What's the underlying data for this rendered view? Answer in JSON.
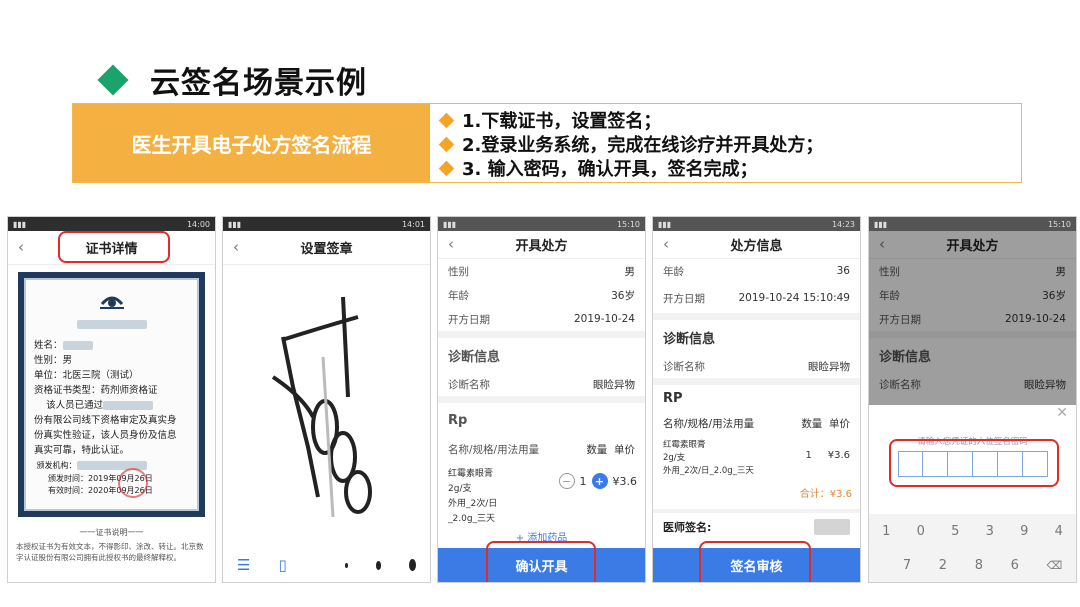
{
  "header": {
    "title": "云签名场景示例"
  },
  "banner": {
    "left_label": "医生开具电子处方签名流程",
    "steps": [
      "1.下载证书，设置签名；",
      "2.登录业务系统，完成在线诊疗并开具处方；",
      "3. 输入密码，确认开具，签名完成；"
    ]
  },
  "phone1": {
    "status_time": "14:00",
    "nav_title": "证书详情",
    "cert": {
      "name_label": "姓名：",
      "gender": "性别：男",
      "unit": "单位：北医三院（测试）",
      "cert_type": "资格证书类型：药剂师资格证",
      "passed": "该人员已通过",
      "line1": "份有限公司线下资格审定及真实身",
      "line2": "份真实性验证，该人员身份及信息",
      "line3": "真实可靠，特此认证。",
      "issuer": "颁发机构：",
      "issue_time": "颁发时间：2019年09月26日",
      "valid_time": "有效时间：2020年09月26日"
    },
    "footer_title": "一一证书说明一一",
    "footer_text": "本授权证书为有效文本，不得影印、涂改、转让。北京数字认证股份有限公司拥有此授权书的最终解释权。"
  },
  "phone2": {
    "status_time": "14:01",
    "nav_title": "设置签章"
  },
  "phone3": {
    "status_time": "15:10",
    "nav_title": "开具处方",
    "rows": [
      {
        "k": "性别",
        "v": "男"
      },
      {
        "k": "年龄",
        "v": "36岁"
      },
      {
        "k": "开方日期",
        "v": "2019-10-24"
      }
    ],
    "diag_title": "诊断信息",
    "diag_name_k": "诊断名称",
    "diag_name_v": "眼睑异物",
    "rp_title": "Rp",
    "drug_header": "名称/规格/用法用量",
    "qty_header": "数量",
    "price_header": "单价",
    "drug_name": "红霉素眼膏",
    "drug_spec": "2g/支",
    "drug_usage": "外用_2次/日_2.0g_三天",
    "qty": "1",
    "price": "¥3.6",
    "add_drug": "+ 添加药品",
    "button": "确认开具"
  },
  "phone4": {
    "status_time": "14:23",
    "nav_title": "处方信息",
    "rows": [
      {
        "k": "年龄",
        "v": "36"
      },
      {
        "k": "开方日期",
        "v": "2019-10-24 15:10:49"
      }
    ],
    "diag_title": "诊断信息",
    "diag_name_k": "诊断名称",
    "diag_name_v": "眼睑异物",
    "rp_title": "RP",
    "drug_header": "名称/规格/用法用量",
    "qty_header": "数量",
    "price_header": "单价",
    "drug_name": "红霉素眼膏",
    "drug_spec": "2g/支",
    "drug_usage": "外用_2次/日_2.0g_三天",
    "qty": "1",
    "price": "¥3.6",
    "total": "合计：¥3.6",
    "signer": "医师签名:",
    "button": "签名审核"
  },
  "phone5": {
    "status_time": "15:10",
    "nav_title": "开具处方",
    "rows": [
      {
        "k": "性别",
        "v": "男"
      },
      {
        "k": "年龄",
        "v": "36岁"
      },
      {
        "k": "开方日期",
        "v": "2019-10-24"
      }
    ],
    "diag_title": "诊断信息",
    "diag_name_k": "诊断名称",
    "diag_name_v": "眼睑异物",
    "pwd_prompt": "请输入您凭证的六位签名密码",
    "keys_row1": [
      "1",
      "0",
      "5",
      "3",
      "9",
      "4"
    ],
    "keys_row2": [
      "7",
      "2",
      "8",
      "6"
    ]
  },
  "colors": {
    "accent_green": "#1aa36a",
    "banner_orange": "#f4b142",
    "button_blue": "#3a7be6",
    "highlight_red": "#e02b2b"
  }
}
